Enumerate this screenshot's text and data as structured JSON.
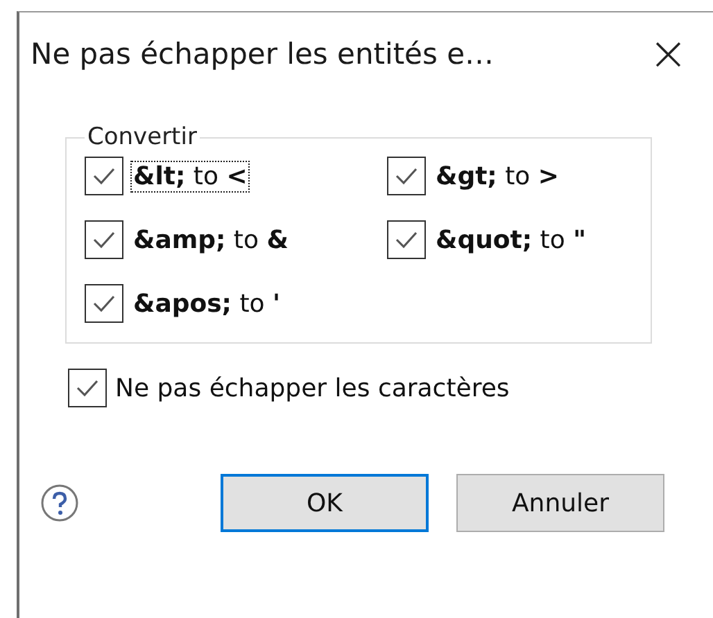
{
  "window": {
    "title": "Ne pas échapper les entités e…",
    "close": "×"
  },
  "group": {
    "legend": "Convertir",
    "options": [
      {
        "label": "**&lt;**  to  **<**",
        "checked": true,
        "focused": true
      },
      {
        "label": "**&gt;**  to  **>**",
        "checked": true,
        "focused": false
      },
      {
        "label": "**&amp;**  to  **&**",
        "checked": true,
        "focused": false
      },
      {
        "label": "**&quot;**  to  **\"**",
        "checked": true,
        "focused": false
      },
      {
        "label": "**&apos;**  to  **'**",
        "checked": true,
        "focused": false
      }
    ]
  },
  "escape_option": {
    "label": "Ne pas échapper les caractères",
    "checked": true
  },
  "buttons": [
    {
      "label": "OK",
      "default": true
    },
    {
      "label": "Annuler",
      "default": false
    }
  ]
}
